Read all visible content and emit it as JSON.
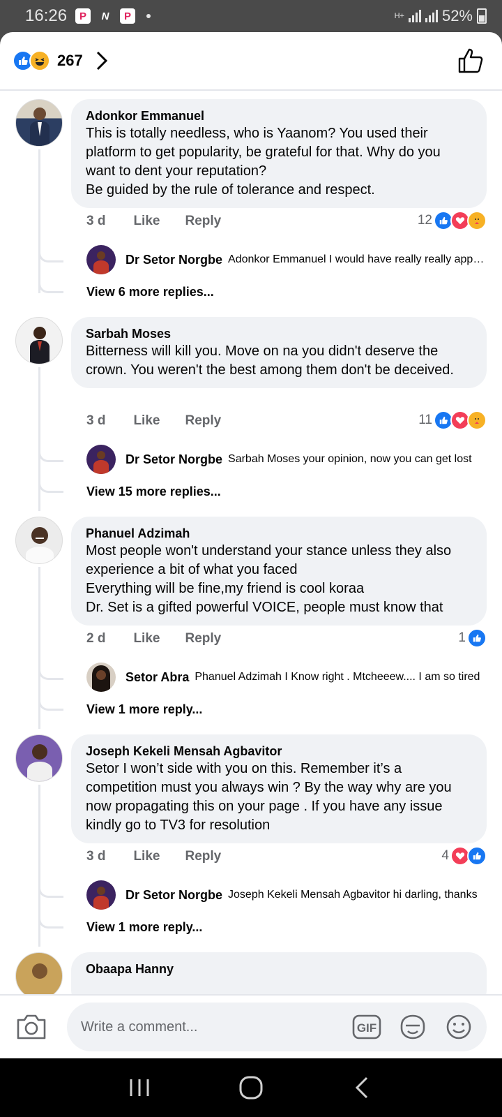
{
  "status_bar": {
    "time": "16:26",
    "battery": "52%",
    "network": "H+"
  },
  "top_bar": {
    "reaction_count": "267",
    "reaction_icons": [
      "like-icon",
      "haha-icon"
    ]
  },
  "comments": [
    {
      "author": "Adonkor Emmanuel",
      "text": "This is totally needless, who is Yaanom? You used their platform to get popularity, be grateful for that. Why do you want to dent your reputation?\nBe guided by the rule of tolerance and respect.",
      "age": "3 d",
      "like_label": "Like",
      "reply_label": "Reply",
      "reaction_count": "12",
      "reactions": [
        "like",
        "love",
        "care"
      ],
      "reply": {
        "author": "Dr Setor Norgbe",
        "snippet": "Adonkor Emmanuel I would have really really appreciated it"
      },
      "view_more": "View 6 more replies..."
    },
    {
      "author": "Sarbah Moses",
      "text": "Bitterness will kill you. Move on na you didn't deserve the crown. You weren't the best among them don't be deceived.",
      "age": "3 d",
      "like_label": "Like",
      "reply_label": "Reply",
      "reaction_count": "11",
      "reactions": [
        "like",
        "love",
        "care"
      ],
      "reply": {
        "author": "Dr Setor Norgbe",
        "snippet": "Sarbah Moses your opinion, now you can get lost"
      },
      "view_more": "View 15 more replies..."
    },
    {
      "author": "Phanuel Adzimah",
      "text": "Most people won't understand your stance unless they also experience a bit of what you faced\nEverything will be fine,my friend is cool koraa\nDr. Set is a gifted powerful VOICE, people must know that",
      "age": "2 d",
      "like_label": "Like",
      "reply_label": "Reply",
      "reaction_count": "1",
      "reactions": [
        "like"
      ],
      "reply": {
        "author": "Setor Abra",
        "snippet": "Phanuel Adzimah  I Know right .  Mtcheeew.... I am so tired"
      },
      "view_more": "View 1 more reply..."
    },
    {
      "author": "Joseph Kekeli Mensah Agbavitor",
      "text": "Setor I won’t side with you on this. Remember it’s a competition must you always win ? By the way why are you now propagating this on your page . If you have any issue kindly go to TV3 for resolution",
      "age": "3 d",
      "like_label": "Like",
      "reply_label": "Reply",
      "reaction_count": "4",
      "reactions": [
        "love",
        "like"
      ],
      "reply": {
        "author": "Dr Setor Norgbe",
        "snippet": "Joseph Kekeli Mensah Agbavitor  hi darling, thanks"
      },
      "view_more": "View 1 more reply..."
    },
    {
      "author": "Obaapa Hanny"
    }
  ],
  "composer": {
    "placeholder": "Write a comment...",
    "gif_label": "GIF"
  }
}
